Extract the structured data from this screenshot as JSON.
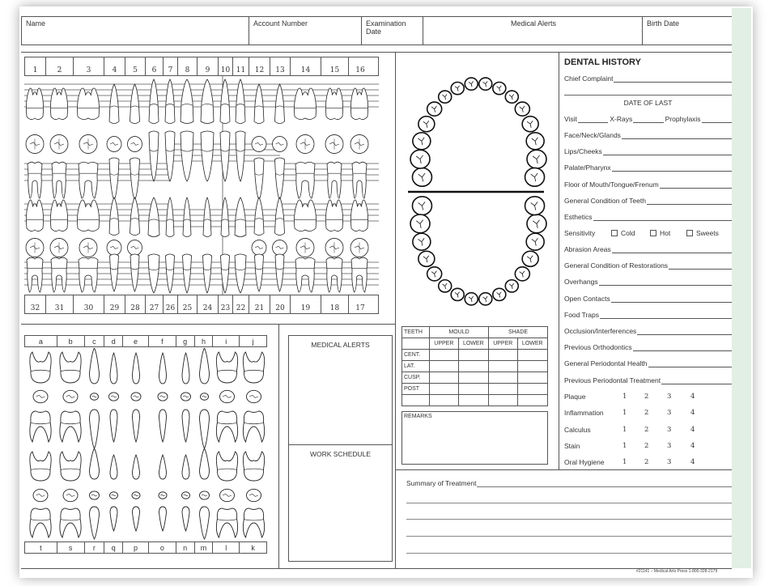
{
  "header": {
    "fields": [
      {
        "label": "Name"
      },
      {
        "label": "Account Number"
      },
      {
        "label": "Examination Date"
      },
      {
        "label": "Medical Alerts"
      },
      {
        "label": "Birth Date"
      }
    ]
  },
  "permanent_chart": {
    "upper_numbers": [
      "1",
      "2",
      "3",
      "4",
      "5",
      "6",
      "7",
      "8",
      "9",
      "10",
      "11",
      "12",
      "13",
      "14",
      "15",
      "16"
    ],
    "lower_numbers": [
      "32",
      "31",
      "30",
      "29",
      "28",
      "27",
      "26",
      "25",
      "24",
      "23",
      "22",
      "21",
      "20",
      "19",
      "18",
      "17"
    ]
  },
  "primary_chart": {
    "upper_letters": [
      "a",
      "b",
      "c",
      "d",
      "e",
      "f",
      "g",
      "h",
      "i",
      "j"
    ],
    "lower_letters": [
      "t",
      "s",
      "r",
      "q",
      "p",
      "o",
      "n",
      "m",
      "l",
      "k"
    ]
  },
  "boxes": {
    "medical_alerts": "MEDICAL ALERTS",
    "work_schedule": "WORK SCHEDULE",
    "remarks": "REMARKS"
  },
  "mould_table": {
    "headers": [
      "TEETH",
      "MOULD",
      "SHADE"
    ],
    "subheaders": [
      "UPPER",
      "LOWER",
      "UPPER",
      "LOWER"
    ],
    "rows": [
      "CENT.",
      "LAT.",
      "CUSP.",
      "POST",
      ""
    ]
  },
  "dental_history": {
    "title": "DENTAL HISTORY",
    "chief_complaint": "Chief Complaint",
    "date_of_last": "DATE OF LAST",
    "visit": "Visit",
    "xrays": "X-Rays",
    "prophylaxis": "Prophylaxis",
    "fields": [
      "Face/Neck/Glands",
      "Lips/Cheeks",
      "Palate/Pharynx",
      "Floor of Mouth/Tongue/Frenum",
      "General Condition of Teeth",
      "Esthetics"
    ],
    "sensitivity": {
      "label": "Sensitivity",
      "options": [
        "Cold",
        "Hot",
        "Sweets"
      ]
    },
    "fields2": [
      "Abrasion Areas",
      "General Condition of Restorations",
      "Overhangs",
      "Open Contacts",
      "Food Traps",
      "Occlusion/Interferences",
      "Previous Orthodontics",
      "General Periodontal Health",
      "Previous Periodontal Treatment"
    ],
    "scales": [
      {
        "label": "Plaque",
        "values": [
          "1",
          "2",
          "3",
          "4"
        ]
      },
      {
        "label": "Inflammation",
        "values": [
          "1",
          "2",
          "3",
          "4"
        ]
      },
      {
        "label": "Calculus",
        "values": [
          "1",
          "2",
          "3",
          "4"
        ]
      },
      {
        "label": "Stain",
        "values": [
          "1",
          "2",
          "3",
          "4"
        ]
      },
      {
        "label": "Oral Hygiene",
        "values": [
          "1",
          "2",
          "3",
          "4"
        ]
      }
    ]
  },
  "summary": {
    "label": "Summary of Treatment"
  },
  "footer": {
    "text": "#21141 – Medical Arts Press    1-800-328-2179"
  },
  "colors": {
    "side_strip": "#e2efe4",
    "line": "#555555"
  }
}
